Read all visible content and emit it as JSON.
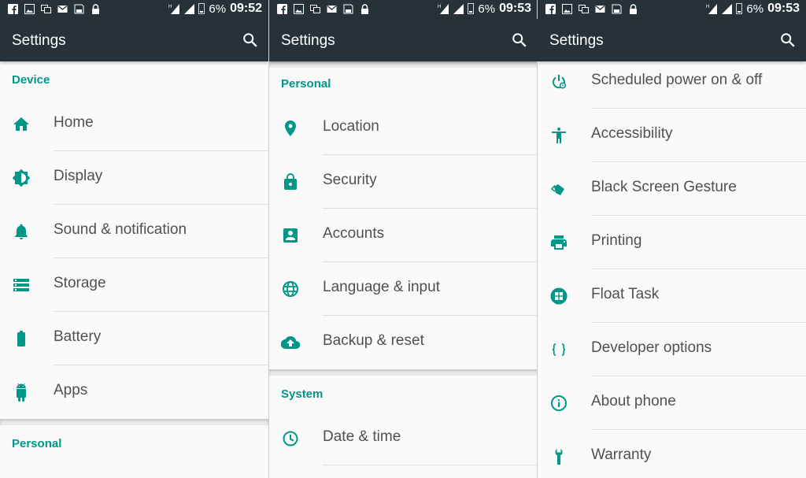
{
  "colors": {
    "toolbar": "#263238",
    "accent": "#009688",
    "text": "#505050"
  },
  "status_bar": {
    "battery": "6%",
    "network": "H",
    "notification_icons": [
      "facebook-icon",
      "image-icon",
      "screen-icon",
      "mail-icon",
      "save-icon",
      "lock-icon"
    ]
  },
  "screens": [
    {
      "title": "Settings",
      "time": "09:52",
      "sections": [
        {
          "header": "Device",
          "items": [
            {
              "label": "Home",
              "icon": "home-icon"
            },
            {
              "label": "Display",
              "icon": "brightness-icon"
            },
            {
              "label": "Sound & notification",
              "icon": "bell-icon"
            },
            {
              "label": "Storage",
              "icon": "storage-icon"
            },
            {
              "label": "Battery",
              "icon": "battery-icon"
            },
            {
              "label": "Apps",
              "icon": "android-icon"
            }
          ]
        },
        {
          "header": "Personal",
          "items": []
        }
      ]
    },
    {
      "title": "Settings",
      "time": "09:53",
      "sections": [
        {
          "header": "Personal",
          "items": [
            {
              "label": "Location",
              "icon": "location-icon"
            },
            {
              "label": "Security",
              "icon": "lock-icon"
            },
            {
              "label": "Accounts",
              "icon": "account-icon"
            },
            {
              "label": "Language & input",
              "icon": "globe-icon"
            },
            {
              "label": "Backup & reset",
              "icon": "cloud-upload-icon"
            }
          ]
        },
        {
          "header": "System",
          "items": [
            {
              "label": "Date & time",
              "icon": "clock-icon"
            }
          ]
        }
      ]
    },
    {
      "title": "Settings",
      "time": "09:53",
      "sections": [
        {
          "header": "",
          "items": [
            {
              "label": "Scheduled power on & off",
              "icon": "power-schedule-icon"
            },
            {
              "label": "Accessibility",
              "icon": "accessibility-icon"
            },
            {
              "label": "Black Screen Gesture",
              "icon": "gesture-icon"
            },
            {
              "label": "Printing",
              "icon": "printer-icon"
            },
            {
              "label": "Float Task",
              "icon": "float-task-icon"
            },
            {
              "label": "Developer options",
              "icon": "braces-icon"
            },
            {
              "label": "About phone",
              "icon": "info-icon"
            },
            {
              "label": "Warranty",
              "icon": "wrench-icon"
            }
          ]
        }
      ]
    }
  ]
}
